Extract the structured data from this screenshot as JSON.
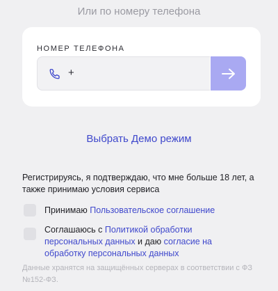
{
  "header": {
    "subtitle": "Или по номеру телефона"
  },
  "phone_form": {
    "label": "НОМЕР ТЕЛЕФОНА",
    "prefix": "+",
    "icon": "phone-icon",
    "submit_icon": "arrow-right-icon"
  },
  "demo": {
    "label": "Выбрать Демо режим"
  },
  "agreement": {
    "text": "Регистрируясь, я подтверждаю, что мне больше 18 лет, а также принимаю условия сервиса",
    "accept_terms": {
      "prefix": "Принимаю ",
      "link": "Пользовательское соглашение",
      "checked": false
    },
    "accept_privacy": {
      "prefix": "Соглашаюсь с ",
      "link_policy_line1": "Политикой обработки",
      "link_policy_line2": "персональных данных",
      "middle": " и даю ",
      "link_consent_line1": "согласие на",
      "link_consent_line2": "обработку персональных данных",
      "checked": false
    }
  },
  "footer": {
    "note": "Данные хранятся на защищённых серверах в соответствии с ФЗ №152-ФЗ."
  },
  "colors": {
    "accent": "#3f48cc",
    "button_bg": "#a9a9f2",
    "page_bg": "#f0f0f2"
  }
}
